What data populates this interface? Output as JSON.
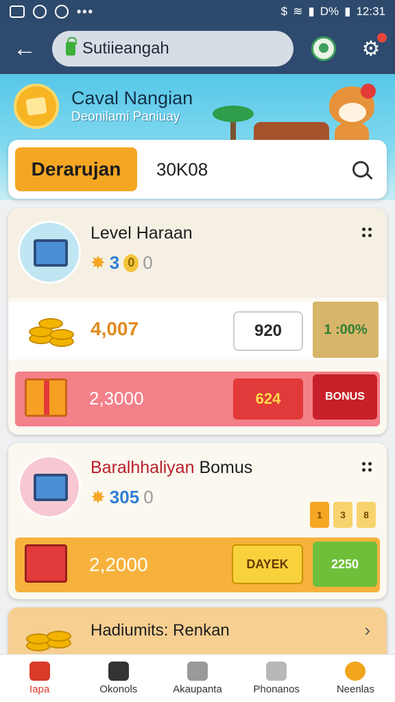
{
  "status_bar": {
    "battery": "D%",
    "time": "12:31"
  },
  "app_bar": {
    "url": "Sutiieangah"
  },
  "banner": {
    "title": "Caval Nangian",
    "subtitle": "Deonilami Paniuay"
  },
  "search": {
    "button_label": "Derarujan",
    "value": "30K08"
  },
  "card1": {
    "title": "Level Haraan",
    "stat_a": "3",
    "stat_b": "0",
    "stat_c": "0",
    "amount": "4,007",
    "input_value": "920",
    "tag": "1 :00%",
    "bonus_amount": "2,3000",
    "bonus_value": "624",
    "bonus_label": "BONUS"
  },
  "card2": {
    "title_a": "Baralhhaliyan",
    "title_b": "Bomus",
    "stat_a": "305",
    "stat_b": "0",
    "chips": [
      "1",
      "3",
      "8"
    ],
    "amount": "2,2000",
    "dayek_label": "DAYEK",
    "green_label": "2250"
  },
  "card3": {
    "title": "Hadiumits: Renkan"
  },
  "nav": [
    {
      "label": "Iapa",
      "color": "#d93a2a"
    },
    {
      "label": "Okonols",
      "color": "#333333"
    },
    {
      "label": "Akaupanta",
      "color": "#8a8a8a"
    },
    {
      "label": "Phonanos",
      "color": "#d93a2a"
    },
    {
      "label": "Neenlas",
      "color": "#f0a51c"
    }
  ]
}
